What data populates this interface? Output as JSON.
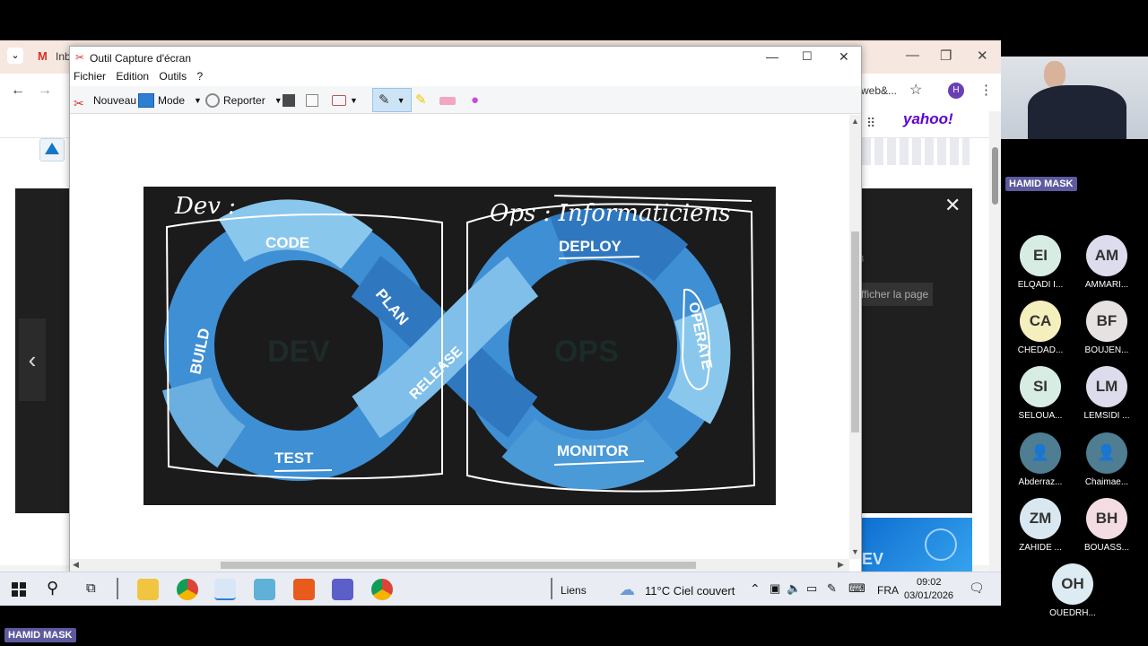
{
  "browser": {
    "tab_partial": "Inb",
    "address_partial": "web&...",
    "profile_initial": "H",
    "yahoo_logo": "yahoo!",
    "video_side_text": "fficher la page",
    "video_side_text2": "3"
  },
  "snip": {
    "title": "Outil Capture d'écran",
    "menu": [
      "Fichier",
      "Edition",
      "Outils",
      "?"
    ],
    "toolbar": {
      "new": "Nouveau",
      "mode": "Mode",
      "report": "Reporter"
    }
  },
  "devops": {
    "handwritten_left": "Dev :",
    "handwritten_right": "Ops : Informaticiens",
    "center_left": "DEV",
    "center_right": "OPS",
    "stages": [
      "CODE",
      "PLAN",
      "BUILD",
      "TEST",
      "RELEASE",
      "DEPLOY",
      "OPERATE",
      "MONITOR"
    ]
  },
  "taskbar": {
    "links": "Liens",
    "weather": "11°C  Ciel couvert",
    "lang": "FRA",
    "time": "09:02",
    "date": "03/01/2026"
  },
  "meeting": {
    "presenter_chip": "HAMID MASK",
    "bottom_chip": "HAMID MASK",
    "participants": [
      {
        "initials": "EI",
        "name": "ELQADI I...",
        "color": "#d7ece2"
      },
      {
        "initials": "AM",
        "name": "AMMARI...",
        "color": "#dcdcec"
      },
      {
        "initials": "CA",
        "name": "CHEDAD...",
        "color": "#f5eebd"
      },
      {
        "initials": "BF",
        "name": "BOUJEN...",
        "color": "#e6e2e2"
      },
      {
        "initials": "SI",
        "name": "SELOUA...",
        "color": "#d7ece2"
      },
      {
        "initials": "LM",
        "name": "LEMSIDI ...",
        "color": "#dcdcec"
      },
      {
        "initials": "",
        "name": "Abderraz...",
        "color": "#4f7d92"
      },
      {
        "initials": "",
        "name": "Chaimae...",
        "color": "#4f7d92"
      },
      {
        "initials": "ZM",
        "name": "ZAHIDE ...",
        "color": "#d9e8f0"
      },
      {
        "initials": "BH",
        "name": "BOUASS...",
        "color": "#f3dde2"
      },
      {
        "initials": "OH",
        "name": "OUEDRH...",
        "color": "#dcecf2"
      }
    ]
  }
}
